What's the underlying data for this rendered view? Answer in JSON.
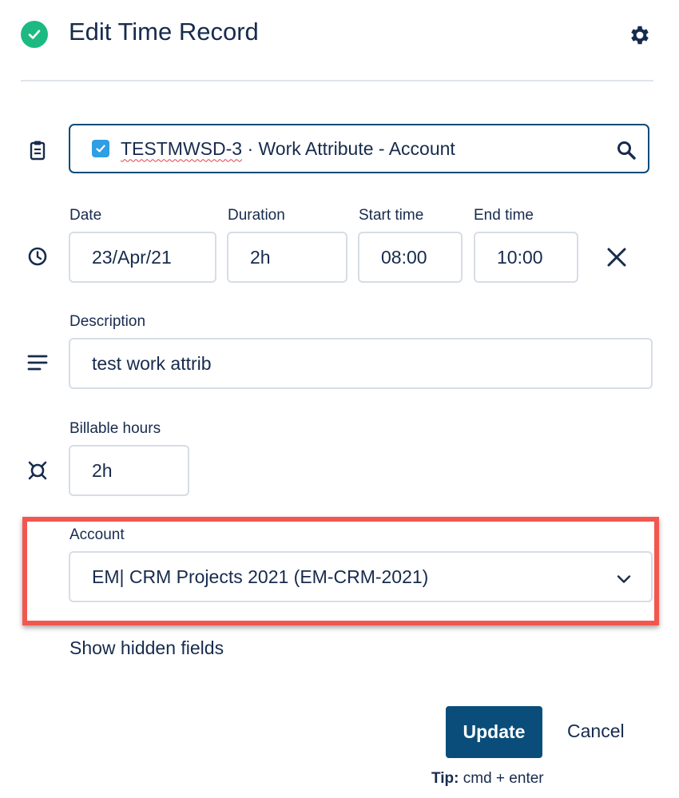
{
  "header": {
    "title": "Edit Time Record",
    "status_icon": "check-circle-icon",
    "settings_icon": "gear-icon"
  },
  "issue": {
    "key": "TESTMWSD-3",
    "separator": " · ",
    "summary": "Work Attribute - Account",
    "icons": [
      "clipboard-icon",
      "checkbox-icon",
      "search-icon"
    ]
  },
  "time": {
    "date_label": "Date",
    "date_value": "23/Apr/21",
    "duration_label": "Duration",
    "duration_value": "2h",
    "start_label": "Start time",
    "start_value": "08:00",
    "end_label": "End time",
    "end_value": "10:00",
    "icons": [
      "clock-icon",
      "close-icon"
    ]
  },
  "description": {
    "label": "Description",
    "value": "test work attrib",
    "icon": "lines-icon"
  },
  "billable": {
    "label": "Billable hours",
    "value": "2h",
    "icon": "currency-icon"
  },
  "account": {
    "label": "Account",
    "selected": "EM| CRM Projects 2021 (EM-CRM-2021)",
    "icon": "chevron-down-icon"
  },
  "footer": {
    "show_hidden_fields": "Show hidden fields",
    "update_label": "Update",
    "cancel_label": "Cancel",
    "tip_label": "Tip:",
    "tip_text": " cmd + enter"
  },
  "colors": {
    "accent": "#0a4d7a",
    "success": "#1cba82",
    "highlight": "#f2574f",
    "text": "#172b4d"
  }
}
